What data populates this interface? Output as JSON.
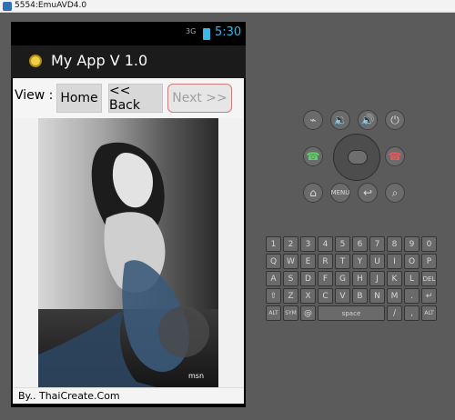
{
  "window": {
    "title": "5554:EmuAVD4.0"
  },
  "phone": {
    "status": {
      "network": "3G",
      "time": "5:30"
    },
    "actionbar": {
      "title": "My App V 1.0"
    },
    "nav": {
      "view_label": "View :",
      "home": "Home",
      "back": "<< Back",
      "next": "Next >>"
    },
    "image": {
      "watermark": "msn"
    },
    "footer": {
      "text": "By.. ThaiCreate.Com"
    }
  },
  "emulator": {
    "controls": {
      "top_row": [
        "camera-icon",
        "volume-down-icon",
        "volume-up-icon",
        "power-icon"
      ],
      "middle_row": [
        "call-icon",
        "dpad",
        "end-call-icon"
      ],
      "bottom_row": [
        "home-icon",
        "menu",
        "back-icon",
        "search-icon"
      ],
      "menu_label": "MENU"
    },
    "keyboard": {
      "rows": [
        [
          "1",
          "2",
          "3",
          "4",
          "5",
          "6",
          "7",
          "8",
          "9",
          "0"
        ],
        [
          "Q",
          "W",
          "E",
          "R",
          "T",
          "Y",
          "U",
          "I",
          "O",
          "P"
        ],
        [
          "A",
          "S",
          "D",
          "F",
          "G",
          "H",
          "J",
          "K",
          "L",
          "DEL"
        ],
        [
          "⇧",
          "Z",
          "X",
          "C",
          "V",
          "B",
          "N",
          "M",
          ".",
          "↵"
        ],
        [
          "ALT",
          "SYM",
          "@",
          "space",
          "/",
          ",",
          "ALT"
        ]
      ]
    }
  }
}
